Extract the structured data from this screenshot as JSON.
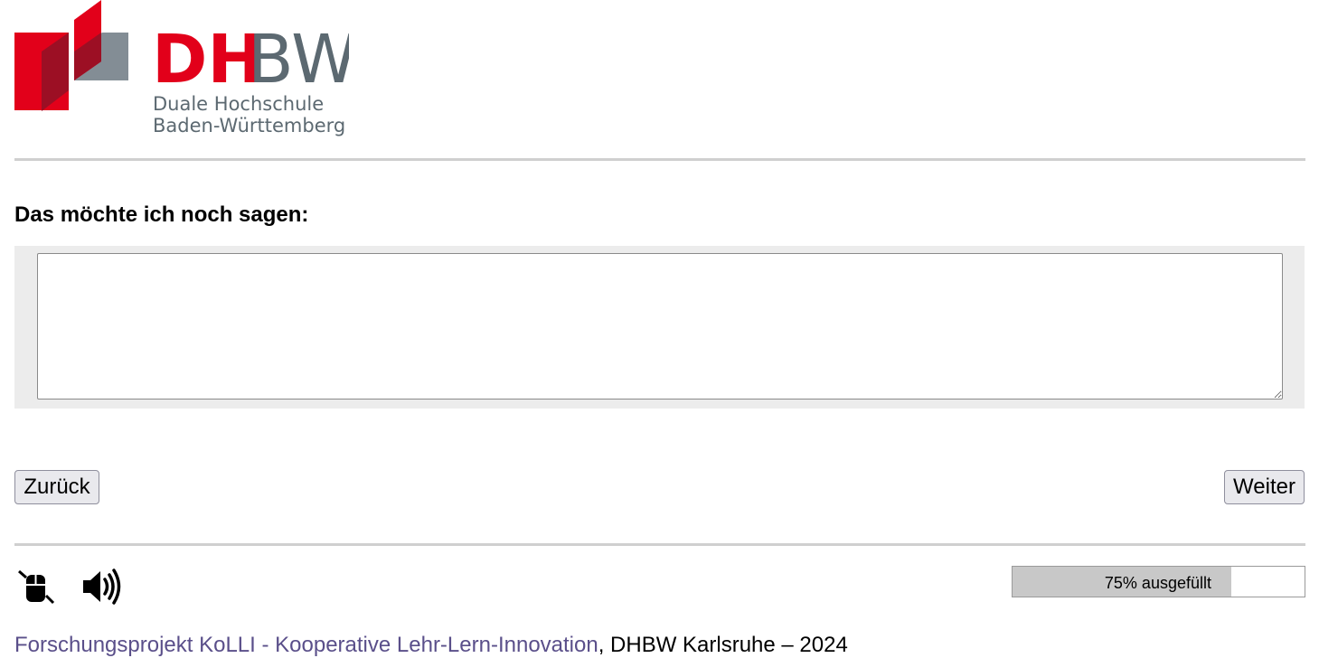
{
  "logo": {
    "wordmark_dh": "DH",
    "wordmark_bw": "BW",
    "line1": "Duale Hochschule",
    "line2": "Baden-Württemberg",
    "colors": {
      "red": "#e2001a",
      "gray": "#5c6971",
      "dark_red": "#9c0f24",
      "light_gray": "#838d95"
    }
  },
  "form": {
    "question": "Das möchte ich noch sagen:",
    "answer_value": "",
    "back_label": "Zurück",
    "next_label": "Weiter"
  },
  "toolbar": {
    "mouse_icon": "mouse-click-icon",
    "speaker_icon": "speaker-volume-icon"
  },
  "progress": {
    "percent": 75,
    "label": "75% ausgefüllt"
  },
  "footer": {
    "link_text": "Forschungsprojekt KoLLI - Kooperative Lehr-Lern-Innovation",
    "rest_text": ", DHBW Karlsruhe – 2024",
    "link_color": "#5a4f8a"
  }
}
